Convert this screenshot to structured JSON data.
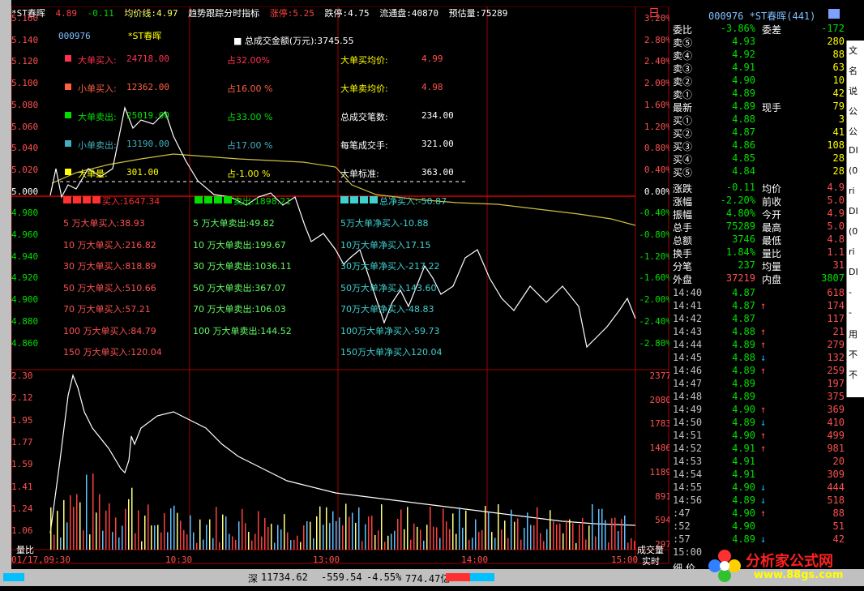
{
  "header": {
    "name": "*ST春晖",
    "price": "4.89",
    "change": "-0.11",
    "avg_label": "均价线:4.97",
    "indicator": "趋势跟踪分时指标",
    "limit_up": "涨停:5.25",
    "limit_down": "跌停:4.75",
    "float": "流通盘:40870",
    "estimate": "预估量:75289",
    "day_label": "日"
  },
  "price_axis": [
    "5.160",
    "5.140",
    "5.120",
    "5.100",
    "5.080",
    "5.060",
    "5.040",
    "5.020",
    "5.000",
    "4.980",
    "4.960",
    "4.940",
    "4.920",
    "4.900",
    "4.880",
    "4.860"
  ],
  "pct_axis": [
    "3.20%",
    "2.80%",
    "2.40%",
    "2.00%",
    "1.60%",
    "1.20%",
    "0.80%",
    "0.40%",
    "0.00%",
    "-0.40%",
    "-0.80%",
    "-1.20%",
    "-1.60%",
    "-2.00%",
    "-2.40%",
    "-2.80%"
  ],
  "vol_ratio_axis": [
    "2.30",
    "2.12",
    "1.95",
    "1.77",
    "1.59",
    "1.41",
    "1.24",
    "1.06"
  ],
  "vol_axis": [
    "2377",
    "2080",
    "1783",
    "1486",
    "1189",
    "891",
    "594",
    "297"
  ],
  "time_axis": [
    "01/17,09:30",
    "10:30",
    "13:00",
    "14:00",
    "15:00"
  ],
  "bottom_labels": {
    "left": "量比",
    "right": "成交量",
    "realtime": "实时"
  },
  "overlay": {
    "code": "000976",
    "name": "*ST春晖",
    "total_amount": "总成交金额(万元):3745.55",
    "rows": [
      {
        "label": "大单买入:",
        "value": "24718.00",
        "pct": "占32.00%",
        "r_label": "大单买均价:",
        "r_value": "4.99",
        "color": "#ff3050"
      },
      {
        "label": "小单买入:",
        "value": "12362.00",
        "pct": "占16.00 %",
        "r_label": "大单卖均价:",
        "r_value": "4.98",
        "color": "#ff6040"
      },
      {
        "label": "大单卖出:",
        "value": "25019.00",
        "pct": "占33.00 %",
        "r_label": "总成交笔数:",
        "r_value": "234.00",
        "color": "#00e000"
      },
      {
        "label": "小单卖出:",
        "value": "13190.00",
        "pct": "占17.00 %",
        "r_label": "每笔成交手:",
        "r_value": "321.00",
        "color": "#40b0c0"
      },
      {
        "label": "大单量:",
        "value": "301.00",
        "pct": "占-1.00 %",
        "r_label": "大单标准:",
        "r_value": "363.00",
        "color": "#ffff00"
      }
    ],
    "net_row": [
      "买入:1647.34",
      "卖出:1898.21",
      "总净买入:-50.87"
    ],
    "tiers": [
      [
        "5 万大单买入:38.93",
        "5 万大单卖出:49.82",
        "5万大单净买入-10.88"
      ],
      [
        "10 万大单买入:216.82",
        "10 万大单卖出:199.67",
        "10万大单净买入17.15"
      ],
      [
        "30 万大单买入:818.89",
        "30 万大单卖出:1036.11",
        "30万大单净买入-217.22"
      ],
      [
        "50 万大单买入:510.66",
        "50 万大单卖出:367.07",
        "50万大单净买入143.60"
      ],
      [
        "70 万大单买入:57.21",
        "70 万大单卖出:106.03",
        "70万大单净买入-48.83"
      ],
      [
        "100 万大单买入:84.79",
        "100 万大单卖出:144.52",
        "100万大单净买入-59.73"
      ],
      [
        "150 万大单买入:120.04",
        "",
        "150万大单净买入120.04"
      ]
    ]
  },
  "panel": {
    "title": "000976 *ST春晖(441)",
    "weibi": [
      "委比",
      "-3.86%",
      "委差",
      "-172"
    ],
    "asks": [
      {
        "label": "卖⑤",
        "price": "4.93",
        "vol": "280"
      },
      {
        "label": "卖④",
        "price": "4.92",
        "vol": "88"
      },
      {
        "label": "卖③",
        "price": "4.91",
        "vol": "63"
      },
      {
        "label": "卖②",
        "price": "4.90",
        "vol": "10"
      },
      {
        "label": "卖①",
        "price": "4.89",
        "vol": "42"
      }
    ],
    "last": [
      "最新",
      "4.89",
      "现手",
      "79"
    ],
    "bids": [
      {
        "label": "买①",
        "price": "4.88",
        "vol": "3"
      },
      {
        "label": "买②",
        "price": "4.87",
        "vol": "41"
      },
      {
        "label": "买③",
        "price": "4.86",
        "vol": "108"
      },
      {
        "label": "买④",
        "price": "4.85",
        "vol": "28"
      },
      {
        "label": "买⑤",
        "price": "4.84",
        "vol": "28"
      }
    ],
    "stats": [
      [
        "涨跌",
        "-0.11",
        "均价",
        "4.9"
      ],
      [
        "涨幅",
        "-2.20%",
        "前收",
        "5.0"
      ],
      [
        "振幅",
        "4.80%",
        "今开",
        "4.9"
      ],
      [
        "总手",
        "75289",
        "最高",
        "5.0"
      ],
      [
        "总额",
        "3746",
        "最低",
        "4.8"
      ],
      [
        "换手",
        "1.84%",
        "量比",
        "1.1"
      ],
      [
        "分笔",
        "237",
        "均量",
        "31"
      ]
    ],
    "outer": [
      "外盘",
      "37219",
      "内盘",
      "3807"
    ],
    "ticks": [
      [
        "14:40",
        "4.87",
        "",
        "618"
      ],
      [
        "14:41",
        "4.87",
        "↑",
        "174"
      ],
      [
        "14:42",
        "4.87",
        "",
        "117"
      ],
      [
        "14:43",
        "4.88",
        "↑",
        "21"
      ],
      [
        "14:44",
        "4.89",
        "↑",
        "279"
      ],
      [
        "14:45",
        "4.88",
        "↓",
        "132"
      ],
      [
        "14:46",
        "4.89",
        "↑",
        "259"
      ],
      [
        "14:47",
        "4.89",
        "",
        "197"
      ],
      [
        "14:48",
        "4.89",
        "",
        "375"
      ],
      [
        "14:49",
        "4.90",
        "↑",
        "369"
      ],
      [
        "14:50",
        "4.89",
        "↓",
        "410"
      ],
      [
        "14:51",
        "4.90",
        "↑",
        "499"
      ],
      [
        "14:52",
        "4.91",
        "↑",
        "981"
      ],
      [
        "14:53",
        "4.91",
        "",
        "20"
      ],
      [
        "14:54",
        "4.91",
        "",
        "309"
      ],
      [
        "14:55",
        "4.90",
        "↓",
        "444"
      ],
      [
        "14:56",
        "4.89",
        "↓",
        "518"
      ],
      [
        ":47",
        "4.90",
        "↑",
        "88"
      ],
      [
        ":52",
        "4.90",
        "",
        "51"
      ],
      [
        ":57",
        "4.89",
        "↓",
        "42"
      ],
      [
        "15:00",
        "",
        "",
        ""
      ]
    ],
    "bottom": [
      "细",
      "价"
    ]
  },
  "status": {
    "market": "深",
    "index": "11734.62",
    "change": "-559.54",
    "pct": "-4.55%",
    "amount": "774.47亿"
  },
  "sidebar_right": [
    "文",
    "名",
    "说",
    "公",
    "公",
    "DI",
    "(0",
    "ri",
    "DI",
    "(0",
    "ri",
    "DI",
    "-",
    "-",
    "用",
    "不",
    "不"
  ],
  "logo": {
    "title": "分析家公式网",
    "url": "www.88gs.com"
  }
}
